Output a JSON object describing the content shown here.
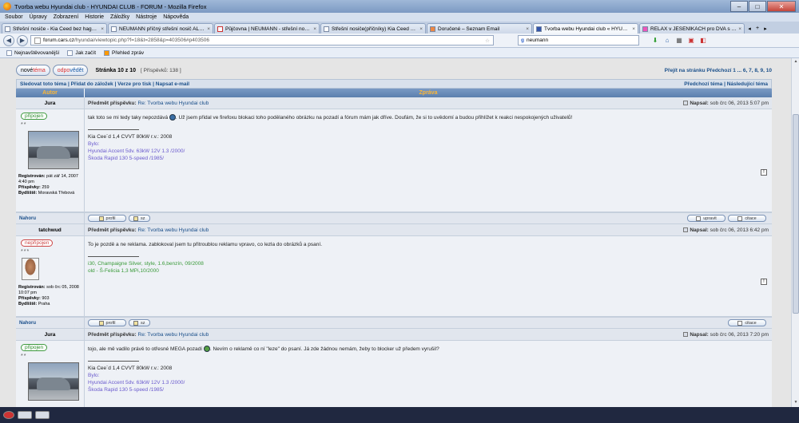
{
  "window": {
    "title": "Tvorba webu Hyundai club - HYUNDAI CLUB - FORUM - Mozilla Firefox",
    "minimize": "–",
    "maximize": "□",
    "close": "✕"
  },
  "menu": [
    "Soubor",
    "Úpravy",
    "Zobrazení",
    "Historie",
    "Záložky",
    "Nástroje",
    "Nápověda"
  ],
  "tabs": [
    {
      "label": "Střešní nosiče - Kia Ceed bez hagusů, ...",
      "close": "×"
    },
    {
      "label": "NEUMANN příčný střešní nosič ALU ...",
      "close": "×"
    },
    {
      "label": "Půjčovna | NEUMANN - střešní nosič...",
      "close": "×"
    },
    {
      "label": "Střešní nosiče(příčníky) Kia Ceed htb ...",
      "close": "×"
    },
    {
      "label": "Doručené – Seznam Email",
      "close": "×"
    },
    {
      "label": "Tvorba webu Hyundai club « HYUND...",
      "close": "×"
    },
    {
      "label": "RELAX v JESENÍKÁCH pro DVA s free ...",
      "close": "×"
    }
  ],
  "tab_scroll": {
    "left": "◂",
    "right": "▸",
    "new": "+"
  },
  "nav": {
    "back": "◀",
    "forward": "▶",
    "url_host": "forum.cars.cz",
    "url_path": "/hyundai/viewtopic.php?f=18&t=2858&p=403506#p403506",
    "search_engine": "g",
    "search_value": "neumann",
    "star": "☆"
  },
  "bookmarks": [
    "Nejnavštěvovanější",
    "Jak začít",
    "Přehled zpráv"
  ],
  "forum": {
    "new_topic": {
      "prefix": "nové ",
      "label": "téma"
    },
    "reply": {
      "prefix": "odpo",
      "label": "vědět"
    },
    "page_info": "Stránka 10 z 10",
    "post_count": "[ Příspěvků: 138 ]",
    "goto": "Přejít na stránku Předchozí 1 ... 6, 7, 8, 9, 10",
    "navrow_left": "Sledovat toto téma | Přidat do záložek | Verze pro tisk | Napsat e-mail",
    "navrow_right": "Předchozí téma | Následující téma",
    "col_author": "Autor",
    "col_message": "Zpráva",
    "subject_label": "Předmět příspěvku:",
    "written_label": "Napsal:",
    "regs_label": "Registrován:",
    "posts_label": "Příspěvky:",
    "city_label": "Bydliště:",
    "top_link": "Nahoru",
    "btn_profile": "profil",
    "btn_pm": "sz",
    "btn_edit": "upravit",
    "btn_quote": "citace",
    "report_icon": "!"
  },
  "posts": [
    {
      "author": "Jura",
      "status": "připojen",
      "rank": "**",
      "subject": "Re: Tvorba webu Hyundai club",
      "written": "sob črc 06, 2013 5:07 pm",
      "registered": "pát zář 14, 2007 4:40 pm",
      "post_count": "259",
      "location": "Moravská Třebová",
      "text_before": "tak toto se mi tedy taky nepozdává",
      "text_after": ". Už jsem přidal ve firefoxu blokaci toho podělaného obrázku na pozadí a fórum mám jak dříve. Doufám, že si to uvědomí a budou přihlížet k reakci nespokojených uživatelů!",
      "sig": [
        "Kia Cee´d 1,4 CVVT 80kW r.v.: 2008",
        "Bylo:",
        "Hyundai Accent 5dv. 63kW 12V 1.3 /2000/",
        "Škoda Rapid 130 5-speed /1985/"
      ]
    },
    {
      "author": "tatchwud",
      "status": "nepřipojen",
      "rank": "***",
      "subject": "Re: Tvorba webu Hyundai club",
      "written": "sob črc 06, 2013 6:42 pm",
      "registered": "sob črc 05, 2008 10:07 pm",
      "post_count": "903",
      "location": "Praha",
      "text": "To je pozdě a ne reklama. zablokoval jsem tu přitroublou reklamu vpravo, co lezla do obrázků a psaní.",
      "sig": [
        "i30, Champaigne Silver, style, 1.6,benzín, 09/2008",
        "old - Š-Felicia 1,3 MPi,10/2000"
      ]
    },
    {
      "author": "Jura",
      "status": "připojen",
      "rank": "**",
      "subject": "Re: Tvorba webu Hyundai club",
      "written": "sob črc 06, 2013 7:20 pm",
      "text_before": "tojo, ale mě vadilo právě to otřesné MEGA pozadí",
      "text_after": ". Nevím o reklamě co ní \"leze\" do psaní. Já zde žádnou nemám, žeby to blocker už předem vyrušil?",
      "sig": [
        "Kia Cee´d 1,4 CVVT 80kW r.v.: 2008",
        "Bylo:",
        "Hyundai Accent 5dv. 63kW 12V 1.3 /2000/",
        "Škoda Rapid 130 5-speed /1985/"
      ]
    }
  ],
  "colors": {
    "link": "#1a4f8a",
    "header_bg": "#5b7fae",
    "header_text": "#ffb733",
    "online": "#2a8a2a",
    "offline": "#cc4444",
    "sig_blue": "#6a5acd",
    "sig_green": "#3a9a3a"
  }
}
